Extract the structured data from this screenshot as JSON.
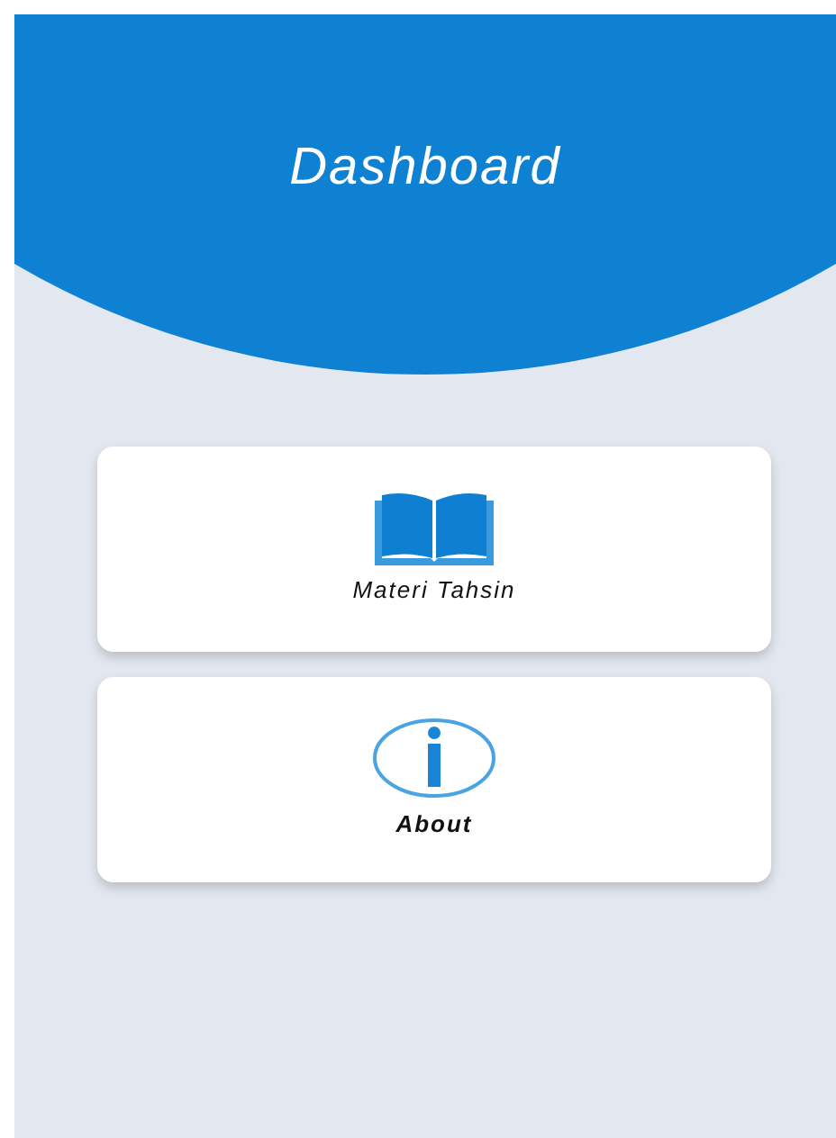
{
  "header": {
    "title": "Dashboard"
  },
  "menu": [
    {
      "kind": "book",
      "label": "Materi Tahsin"
    },
    {
      "kind": "info",
      "label": "About"
    }
  ]
}
